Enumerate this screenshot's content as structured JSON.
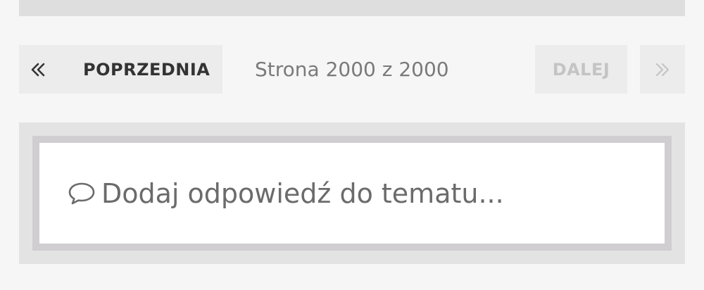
{
  "pagination": {
    "first_icon": "double-chevron-left-icon",
    "prev_label": "POPRZEDNIA",
    "page_indicator": "Strona 2000 z 2000",
    "next_label": "DALEJ",
    "last_icon": "double-chevron-right-icon"
  },
  "reply": {
    "icon": "speech-bubble-icon",
    "placeholder": "Dodaj odpowiedź do tematu..."
  },
  "colors": {
    "background": "#f6f6f6",
    "button_bg": "#ececec",
    "text_dark": "#333333",
    "text_muted": "#7a7a7a",
    "text_disabled": "#c4c4c4"
  }
}
